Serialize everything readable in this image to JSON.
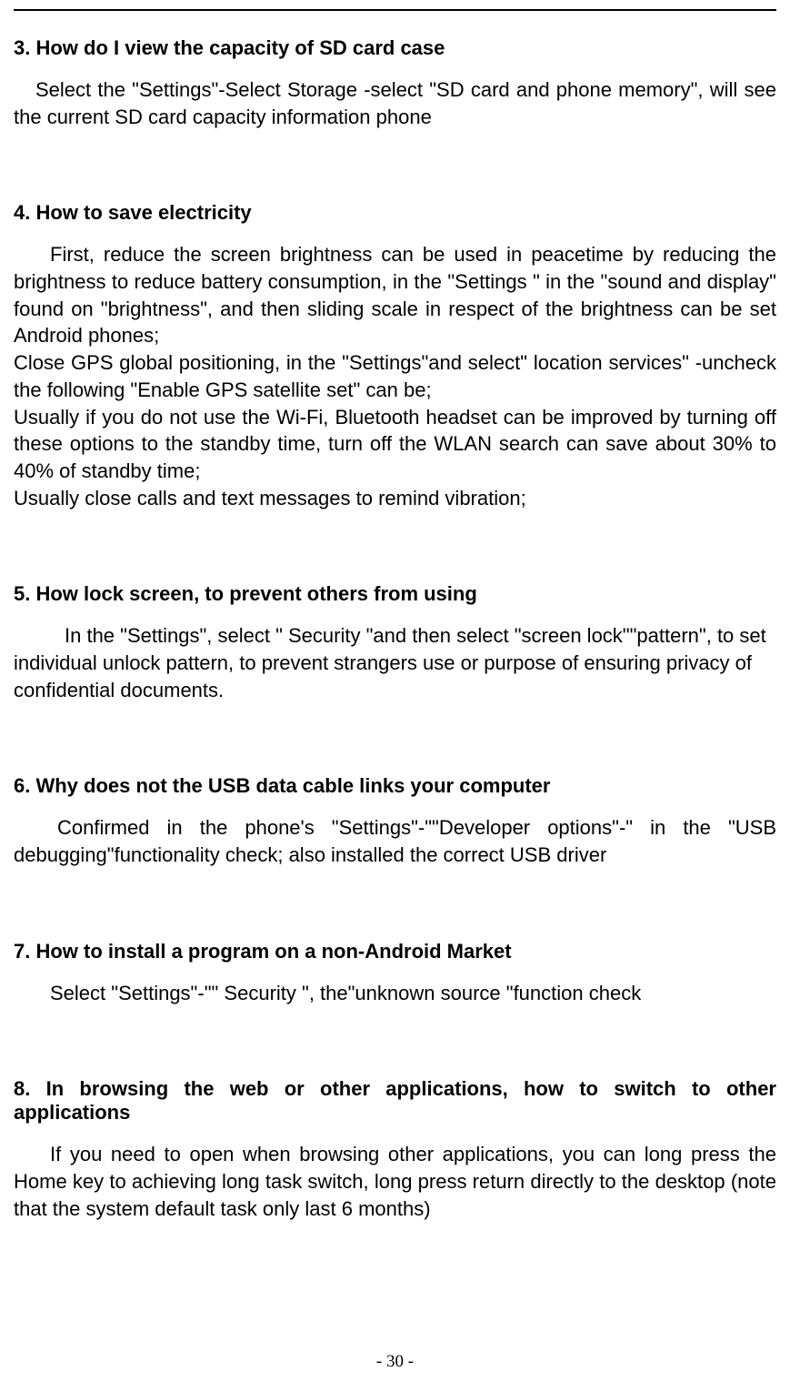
{
  "s3": {
    "heading": "3. How do I view the capacity of SD card case",
    "body": "Select the \"Settings\"-Select Storage -select \"SD card and phone memory\", will see the current SD card capacity information phone"
  },
  "s4": {
    "heading": "4. How to save electricity",
    "p1": "First, reduce the screen brightness can be used in peacetime by reducing the brightness to reduce battery consumption, in the \"Settings \" in the \"sound and display\" found on \"brightness\", and then sliding scale in respect of the brightness can be set Android phones;",
    "p2": "Close GPS global positioning, in the \"Settings\"and select\" location services\" -uncheck the following \"Enable GPS satellite set\" can be;",
    "p3": "Usually if you do not use the Wi-Fi, Bluetooth headset can be improved by turning off these options to the standby time, turn off the WLAN search can save about 30% to 40% of standby time;",
    "p4": "Usually close calls and text messages to remind vibration;"
  },
  "s5": {
    "heading": "5. How    lock screen, to prevent others from using",
    "body": "In the \"Settings\", select \" Security \"and then select \"screen lock\"\"pattern\", to set individual unlock pattern, to prevent strangers use or purpose of ensuring privacy of confidential documents."
  },
  "s6": {
    "heading": "6. Why does not the USB data cable links your computer",
    "body": "Confirmed in the phone's \"Settings\"-\"\"Developer options\"-\"    in the \"USB debugging\"functionality check; also installed the correct USB driver"
  },
  "s7": {
    "heading": "7. How to install a program on a non-Android Market",
    "body": "Select \"Settings\"-\"\" Security \", the\"unknown source \"function check"
  },
  "s8": {
    "heading": "8. In browsing the web or other applications, how to switch to other applications",
    "body": "If you need to open when browsing other applications, you can long press the Home key to achieving long task switch, long press return directly to the desktop (note that the system default task only last 6 months)"
  },
  "page_number": "- 30 -"
}
